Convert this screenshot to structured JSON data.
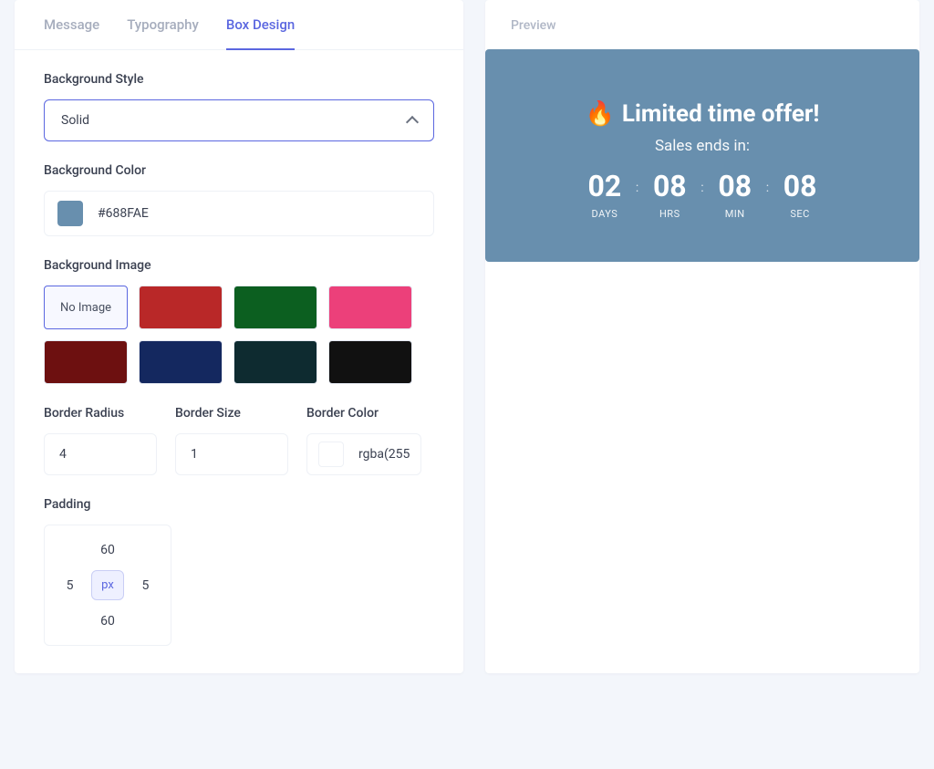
{
  "tabs": [
    {
      "label": "Message",
      "active": false
    },
    {
      "label": "Typography",
      "active": false
    },
    {
      "label": "Box Design",
      "active": true
    }
  ],
  "background_style": {
    "label": "Background Style",
    "value": "Solid"
  },
  "background_color": {
    "label": "Background Color",
    "value": "#688FAE"
  },
  "background_image": {
    "label": "Background Image",
    "no_image_label": "No Image",
    "options": [
      {
        "id": "none",
        "selected": true
      },
      {
        "id": "red",
        "color": "#b92828"
      },
      {
        "id": "green",
        "color": "#0c5f20"
      },
      {
        "id": "pink",
        "color": "#ec407a"
      },
      {
        "id": "dred",
        "color": "#6d1010"
      },
      {
        "id": "navy",
        "color": "#14285f"
      },
      {
        "id": "teal",
        "color": "#0e2b30"
      },
      {
        "id": "black",
        "color": "#111111"
      }
    ]
  },
  "border": {
    "radius_label": "Border Radius",
    "radius_value": "4",
    "size_label": "Border Size",
    "size_value": "1",
    "color_label": "Border Color",
    "color_value": "rgba(255"
  },
  "padding": {
    "label": "Padding",
    "top": "60",
    "right": "5",
    "bottom": "60",
    "left": "5",
    "unit": "px"
  },
  "preview": {
    "label": "Preview",
    "offer_emoji": "🔥",
    "offer_title": "Limited time offer!",
    "offer_subtitle": "Sales ends in:",
    "countdown": {
      "days": {
        "value": "02",
        "label": "DAYS"
      },
      "hours": {
        "value": "08",
        "label": "HRS"
      },
      "mins": {
        "value": "08",
        "label": "MIN"
      },
      "secs": {
        "value": "08",
        "label": "SEC"
      },
      "separator": ":"
    }
  }
}
